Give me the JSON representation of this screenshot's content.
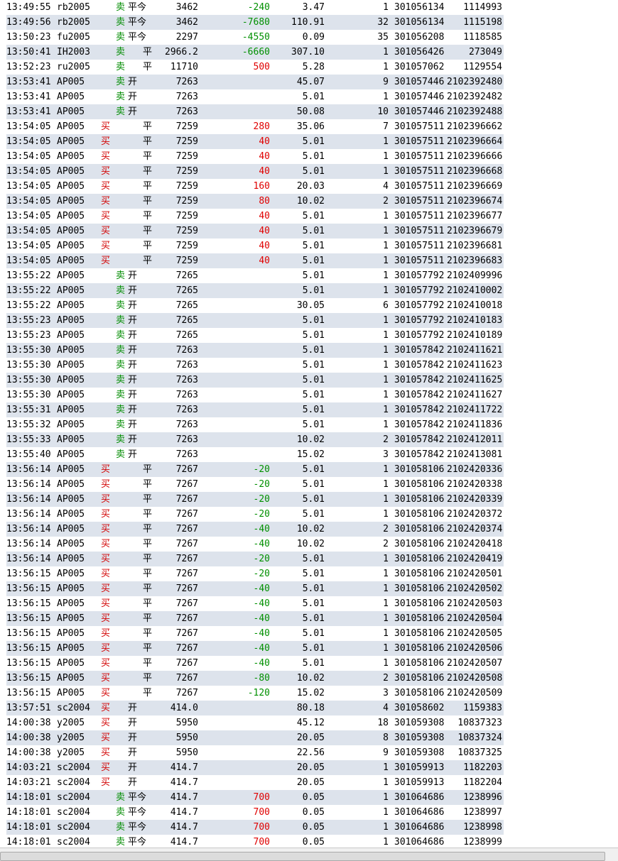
{
  "trade_log": {
    "rows": [
      {
        "time": "13:49:55",
        "symbol": "rb2005",
        "direction": "卖",
        "offset": "平今",
        "price": "3462",
        "pnl": "-240",
        "fee": "3.47",
        "qty": "1",
        "order_id": "301056134",
        "trade_id": "1114993"
      },
      {
        "time": "13:49:56",
        "symbol": "rb2005",
        "direction": "卖",
        "offset": "平今",
        "price": "3462",
        "pnl": "-7680",
        "fee": "110.91",
        "qty": "32",
        "order_id": "301056134",
        "trade_id": "1115198"
      },
      {
        "time": "13:50:23",
        "symbol": "fu2005",
        "direction": "卖",
        "offset": "平今",
        "price": "2297",
        "pnl": "-4550",
        "fee": "0.09",
        "qty": "35",
        "order_id": "301056208",
        "trade_id": "1118585"
      },
      {
        "time": "13:50:41",
        "symbol": "IH2003",
        "direction": "卖",
        "offset": "平",
        "price": "2966.2",
        "pnl": "-6660",
        "fee": "307.10",
        "qty": "1",
        "order_id": "301056426",
        "trade_id": "273049"
      },
      {
        "time": "13:52:23",
        "symbol": "ru2005",
        "direction": "卖",
        "offset": "平",
        "price": "11710",
        "pnl": "500",
        "fee": "5.28",
        "qty": "1",
        "order_id": "301057062",
        "trade_id": "1129554"
      },
      {
        "time": "13:53:41",
        "symbol": "AP005",
        "direction": "卖",
        "offset": "开",
        "price": "7263",
        "pnl": "",
        "fee": "45.07",
        "qty": "9",
        "order_id": "301057446",
        "trade_id": "2102392480"
      },
      {
        "time": "13:53:41",
        "symbol": "AP005",
        "direction": "卖",
        "offset": "开",
        "price": "7263",
        "pnl": "",
        "fee": "5.01",
        "qty": "1",
        "order_id": "301057446",
        "trade_id": "2102392482"
      },
      {
        "time": "13:53:41",
        "symbol": "AP005",
        "direction": "卖",
        "offset": "开",
        "price": "7263",
        "pnl": "",
        "fee": "50.08",
        "qty": "10",
        "order_id": "301057446",
        "trade_id": "2102392488"
      },
      {
        "time": "13:54:05",
        "symbol": "AP005",
        "direction": "买",
        "offset": "平",
        "price": "7259",
        "pnl": "280",
        "fee": "35.06",
        "qty": "7",
        "order_id": "301057511",
        "trade_id": "2102396662"
      },
      {
        "time": "13:54:05",
        "symbol": "AP005",
        "direction": "买",
        "offset": "平",
        "price": "7259",
        "pnl": "40",
        "fee": "5.01",
        "qty": "1",
        "order_id": "301057511",
        "trade_id": "2102396664"
      },
      {
        "time": "13:54:05",
        "symbol": "AP005",
        "direction": "买",
        "offset": "平",
        "price": "7259",
        "pnl": "40",
        "fee": "5.01",
        "qty": "1",
        "order_id": "301057511",
        "trade_id": "2102396666"
      },
      {
        "time": "13:54:05",
        "symbol": "AP005",
        "direction": "买",
        "offset": "平",
        "price": "7259",
        "pnl": "40",
        "fee": "5.01",
        "qty": "1",
        "order_id": "301057511",
        "trade_id": "2102396668"
      },
      {
        "time": "13:54:05",
        "symbol": "AP005",
        "direction": "买",
        "offset": "平",
        "price": "7259",
        "pnl": "160",
        "fee": "20.03",
        "qty": "4",
        "order_id": "301057511",
        "trade_id": "2102396669"
      },
      {
        "time": "13:54:05",
        "symbol": "AP005",
        "direction": "买",
        "offset": "平",
        "price": "7259",
        "pnl": "80",
        "fee": "10.02",
        "qty": "2",
        "order_id": "301057511",
        "trade_id": "2102396674"
      },
      {
        "time": "13:54:05",
        "symbol": "AP005",
        "direction": "买",
        "offset": "平",
        "price": "7259",
        "pnl": "40",
        "fee": "5.01",
        "qty": "1",
        "order_id": "301057511",
        "trade_id": "2102396677"
      },
      {
        "time": "13:54:05",
        "symbol": "AP005",
        "direction": "买",
        "offset": "平",
        "price": "7259",
        "pnl": "40",
        "fee": "5.01",
        "qty": "1",
        "order_id": "301057511",
        "trade_id": "2102396679"
      },
      {
        "time": "13:54:05",
        "symbol": "AP005",
        "direction": "买",
        "offset": "平",
        "price": "7259",
        "pnl": "40",
        "fee": "5.01",
        "qty": "1",
        "order_id": "301057511",
        "trade_id": "2102396681"
      },
      {
        "time": "13:54:05",
        "symbol": "AP005",
        "direction": "买",
        "offset": "平",
        "price": "7259",
        "pnl": "40",
        "fee": "5.01",
        "qty": "1",
        "order_id": "301057511",
        "trade_id": "2102396683"
      },
      {
        "time": "13:55:22",
        "symbol": "AP005",
        "direction": "卖",
        "offset": "开",
        "price": "7265",
        "pnl": "",
        "fee": "5.01",
        "qty": "1",
        "order_id": "301057792",
        "trade_id": "2102409996"
      },
      {
        "time": "13:55:22",
        "symbol": "AP005",
        "direction": "卖",
        "offset": "开",
        "price": "7265",
        "pnl": "",
        "fee": "5.01",
        "qty": "1",
        "order_id": "301057792",
        "trade_id": "2102410002"
      },
      {
        "time": "13:55:22",
        "symbol": "AP005",
        "direction": "卖",
        "offset": "开",
        "price": "7265",
        "pnl": "",
        "fee": "30.05",
        "qty": "6",
        "order_id": "301057792",
        "trade_id": "2102410018"
      },
      {
        "time": "13:55:23",
        "symbol": "AP005",
        "direction": "卖",
        "offset": "开",
        "price": "7265",
        "pnl": "",
        "fee": "5.01",
        "qty": "1",
        "order_id": "301057792",
        "trade_id": "2102410183"
      },
      {
        "time": "13:55:23",
        "symbol": "AP005",
        "direction": "卖",
        "offset": "开",
        "price": "7265",
        "pnl": "",
        "fee": "5.01",
        "qty": "1",
        "order_id": "301057792",
        "trade_id": "2102410189"
      },
      {
        "time": "13:55:30",
        "symbol": "AP005",
        "direction": "卖",
        "offset": "开",
        "price": "7263",
        "pnl": "",
        "fee": "5.01",
        "qty": "1",
        "order_id": "301057842",
        "trade_id": "2102411621"
      },
      {
        "time": "13:55:30",
        "symbol": "AP005",
        "direction": "卖",
        "offset": "开",
        "price": "7263",
        "pnl": "",
        "fee": "5.01",
        "qty": "1",
        "order_id": "301057842",
        "trade_id": "2102411623"
      },
      {
        "time": "13:55:30",
        "symbol": "AP005",
        "direction": "卖",
        "offset": "开",
        "price": "7263",
        "pnl": "",
        "fee": "5.01",
        "qty": "1",
        "order_id": "301057842",
        "trade_id": "2102411625"
      },
      {
        "time": "13:55:30",
        "symbol": "AP005",
        "direction": "卖",
        "offset": "开",
        "price": "7263",
        "pnl": "",
        "fee": "5.01",
        "qty": "1",
        "order_id": "301057842",
        "trade_id": "2102411627"
      },
      {
        "time": "13:55:31",
        "symbol": "AP005",
        "direction": "卖",
        "offset": "开",
        "price": "7263",
        "pnl": "",
        "fee": "5.01",
        "qty": "1",
        "order_id": "301057842",
        "trade_id": "2102411722"
      },
      {
        "time": "13:55:32",
        "symbol": "AP005",
        "direction": "卖",
        "offset": "开",
        "price": "7263",
        "pnl": "",
        "fee": "5.01",
        "qty": "1",
        "order_id": "301057842",
        "trade_id": "2102411836"
      },
      {
        "time": "13:55:33",
        "symbol": "AP005",
        "direction": "卖",
        "offset": "开",
        "price": "7263",
        "pnl": "",
        "fee": "10.02",
        "qty": "2",
        "order_id": "301057842",
        "trade_id": "2102412011"
      },
      {
        "time": "13:55:40",
        "symbol": "AP005",
        "direction": "卖",
        "offset": "开",
        "price": "7263",
        "pnl": "",
        "fee": "15.02",
        "qty": "3",
        "order_id": "301057842",
        "trade_id": "2102413081"
      },
      {
        "time": "13:56:14",
        "symbol": "AP005",
        "direction": "买",
        "offset": "平",
        "price": "7267",
        "pnl": "-20",
        "fee": "5.01",
        "qty": "1",
        "order_id": "301058106",
        "trade_id": "2102420336"
      },
      {
        "time": "13:56:14",
        "symbol": "AP005",
        "direction": "买",
        "offset": "平",
        "price": "7267",
        "pnl": "-20",
        "fee": "5.01",
        "qty": "1",
        "order_id": "301058106",
        "trade_id": "2102420338"
      },
      {
        "time": "13:56:14",
        "symbol": "AP005",
        "direction": "买",
        "offset": "平",
        "price": "7267",
        "pnl": "-20",
        "fee": "5.01",
        "qty": "1",
        "order_id": "301058106",
        "trade_id": "2102420339"
      },
      {
        "time": "13:56:14",
        "symbol": "AP005",
        "direction": "买",
        "offset": "平",
        "price": "7267",
        "pnl": "-20",
        "fee": "5.01",
        "qty": "1",
        "order_id": "301058106",
        "trade_id": "2102420372"
      },
      {
        "time": "13:56:14",
        "symbol": "AP005",
        "direction": "买",
        "offset": "平",
        "price": "7267",
        "pnl": "-40",
        "fee": "10.02",
        "qty": "2",
        "order_id": "301058106",
        "trade_id": "2102420374"
      },
      {
        "time": "13:56:14",
        "symbol": "AP005",
        "direction": "买",
        "offset": "平",
        "price": "7267",
        "pnl": "-40",
        "fee": "10.02",
        "qty": "2",
        "order_id": "301058106",
        "trade_id": "2102420418"
      },
      {
        "time": "13:56:14",
        "symbol": "AP005",
        "direction": "买",
        "offset": "平",
        "price": "7267",
        "pnl": "-20",
        "fee": "5.01",
        "qty": "1",
        "order_id": "301058106",
        "trade_id": "2102420419"
      },
      {
        "time": "13:56:15",
        "symbol": "AP005",
        "direction": "买",
        "offset": "平",
        "price": "7267",
        "pnl": "-20",
        "fee": "5.01",
        "qty": "1",
        "order_id": "301058106",
        "trade_id": "2102420501"
      },
      {
        "time": "13:56:15",
        "symbol": "AP005",
        "direction": "买",
        "offset": "平",
        "price": "7267",
        "pnl": "-40",
        "fee": "5.01",
        "qty": "1",
        "order_id": "301058106",
        "trade_id": "2102420502"
      },
      {
        "time": "13:56:15",
        "symbol": "AP005",
        "direction": "买",
        "offset": "平",
        "price": "7267",
        "pnl": "-40",
        "fee": "5.01",
        "qty": "1",
        "order_id": "301058106",
        "trade_id": "2102420503"
      },
      {
        "time": "13:56:15",
        "symbol": "AP005",
        "direction": "买",
        "offset": "平",
        "price": "7267",
        "pnl": "-40",
        "fee": "5.01",
        "qty": "1",
        "order_id": "301058106",
        "trade_id": "2102420504"
      },
      {
        "time": "13:56:15",
        "symbol": "AP005",
        "direction": "买",
        "offset": "平",
        "price": "7267",
        "pnl": "-40",
        "fee": "5.01",
        "qty": "1",
        "order_id": "301058106",
        "trade_id": "2102420505"
      },
      {
        "time": "13:56:15",
        "symbol": "AP005",
        "direction": "买",
        "offset": "平",
        "price": "7267",
        "pnl": "-40",
        "fee": "5.01",
        "qty": "1",
        "order_id": "301058106",
        "trade_id": "2102420506"
      },
      {
        "time": "13:56:15",
        "symbol": "AP005",
        "direction": "买",
        "offset": "平",
        "price": "7267",
        "pnl": "-40",
        "fee": "5.01",
        "qty": "1",
        "order_id": "301058106",
        "trade_id": "2102420507"
      },
      {
        "time": "13:56:15",
        "symbol": "AP005",
        "direction": "买",
        "offset": "平",
        "price": "7267",
        "pnl": "-80",
        "fee": "10.02",
        "qty": "2",
        "order_id": "301058106",
        "trade_id": "2102420508"
      },
      {
        "time": "13:56:15",
        "symbol": "AP005",
        "direction": "买",
        "offset": "平",
        "price": "7267",
        "pnl": "-120",
        "fee": "15.02",
        "qty": "3",
        "order_id": "301058106",
        "trade_id": "2102420509"
      },
      {
        "time": "13:57:51",
        "symbol": "sc2004",
        "direction": "买",
        "offset": "开",
        "price": "414.0",
        "pnl": "",
        "fee": "80.18",
        "qty": "4",
        "order_id": "301058602",
        "trade_id": "1159383"
      },
      {
        "time": "14:00:38",
        "symbol": "y2005",
        "direction": "买",
        "offset": "开",
        "price": "5950",
        "pnl": "",
        "fee": "45.12",
        "qty": "18",
        "order_id": "301059308",
        "trade_id": "10837323"
      },
      {
        "time": "14:00:38",
        "symbol": "y2005",
        "direction": "买",
        "offset": "开",
        "price": "5950",
        "pnl": "",
        "fee": "20.05",
        "qty": "8",
        "order_id": "301059308",
        "trade_id": "10837324"
      },
      {
        "time": "14:00:38",
        "symbol": "y2005",
        "direction": "买",
        "offset": "开",
        "price": "5950",
        "pnl": "",
        "fee": "22.56",
        "qty": "9",
        "order_id": "301059308",
        "trade_id": "10837325"
      },
      {
        "time": "14:03:21",
        "symbol": "sc2004",
        "direction": "买",
        "offset": "开",
        "price": "414.7",
        "pnl": "",
        "fee": "20.05",
        "qty": "1",
        "order_id": "301059913",
        "trade_id": "1182203"
      },
      {
        "time": "14:03:21",
        "symbol": "sc2004",
        "direction": "买",
        "offset": "开",
        "price": "414.7",
        "pnl": "",
        "fee": "20.05",
        "qty": "1",
        "order_id": "301059913",
        "trade_id": "1182204"
      },
      {
        "time": "14:18:01",
        "symbol": "sc2004",
        "direction": "卖",
        "offset": "平今",
        "price": "414.7",
        "pnl": "700",
        "fee": "0.05",
        "qty": "1",
        "order_id": "301064686",
        "trade_id": "1238996"
      },
      {
        "time": "14:18:01",
        "symbol": "sc2004",
        "direction": "卖",
        "offset": "平今",
        "price": "414.7",
        "pnl": "700",
        "fee": "0.05",
        "qty": "1",
        "order_id": "301064686",
        "trade_id": "1238997"
      },
      {
        "time": "14:18:01",
        "symbol": "sc2004",
        "direction": "卖",
        "offset": "平今",
        "price": "414.7",
        "pnl": "700",
        "fee": "0.05",
        "qty": "1",
        "order_id": "301064686",
        "trade_id": "1238998"
      },
      {
        "time": "14:18:01",
        "symbol": "sc2004",
        "direction": "卖",
        "offset": "平今",
        "price": "414.7",
        "pnl": "700",
        "fee": "0.05",
        "qty": "1",
        "order_id": "301064686",
        "trade_id": "1238999"
      }
    ]
  },
  "colors": {
    "buy": "#d20000",
    "sell": "#008c00",
    "pnl_positive": "#e00000",
    "pnl_negative": "#009000",
    "row_alt_background": "#dde3ec"
  }
}
